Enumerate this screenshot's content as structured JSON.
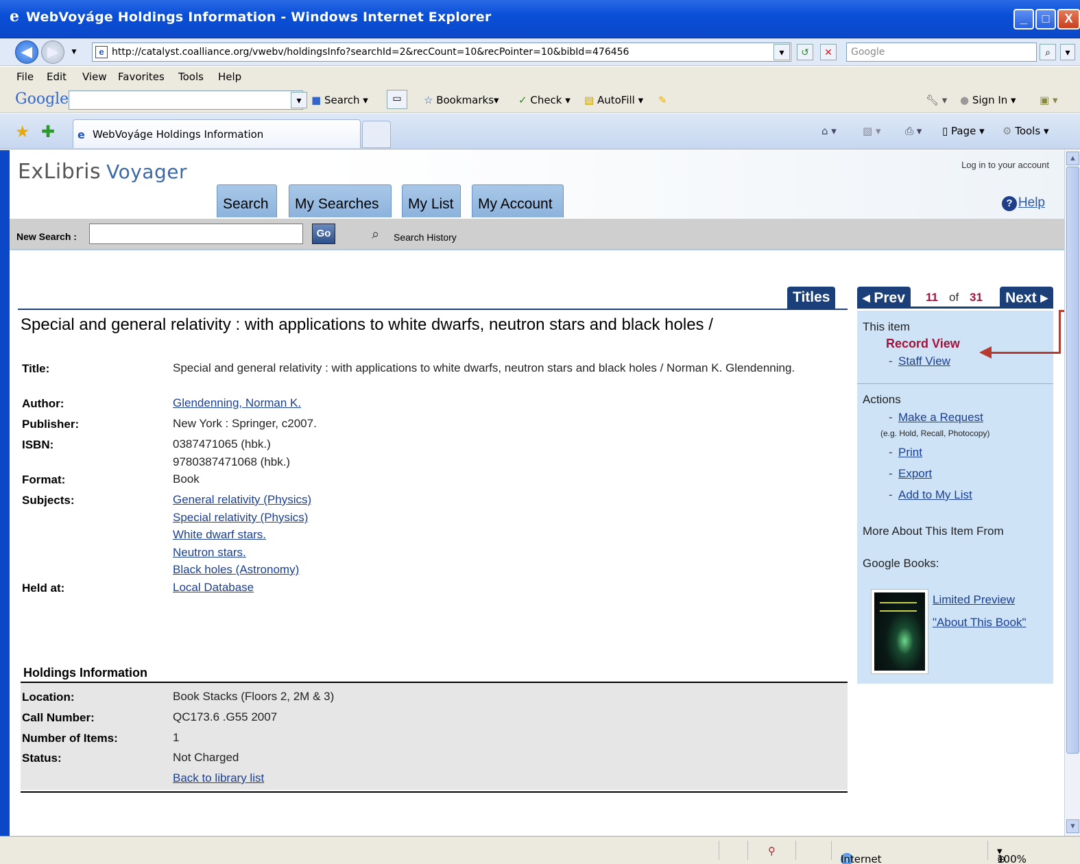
{
  "window": {
    "title": "WebVoyáge Holdings Information - Windows Internet Explorer",
    "url": "http://catalyst.coalliance.org/vwebv/holdingsInfo?searchId=2&recCount=10&recPointer=10&bibId=476456",
    "search_placeholder": "Google",
    "minimize": "_",
    "maximize": "□",
    "close": "X"
  },
  "menu": [
    "File",
    "Edit",
    "View",
    "Favorites",
    "Tools",
    "Help"
  ],
  "google_toolbar": {
    "logo": "Google",
    "search": "Search ▾",
    "bookmarks": "Bookmarks▾",
    "check": "Check ▾",
    "autofill": "AutoFill ▾",
    "sign_in": "Sign In ▾"
  },
  "tabs": {
    "active_tab": "WebVoyáge Holdings Information",
    "page_menu": "Page ▾",
    "tools_menu": "Tools ▾"
  },
  "header": {
    "logo_main": "ExLibris",
    "logo_sub": "Voyager",
    "login_link": "Log in",
    "login_suffix": " to your account",
    "nav_tabs": [
      "Search",
      "My Searches",
      "My List",
      "My Account"
    ],
    "help": "Help",
    "new_search_label": "New Search :",
    "go": "Go",
    "search_history": "Search History"
  },
  "pager": {
    "titles": "Titles",
    "prev": "◂ Prev",
    "current": "11",
    "of": "of",
    "total": "31",
    "next": "Next ▸"
  },
  "record": {
    "heading": "Special and general relativity : with applications to white dwarfs, neutron stars and black holes /",
    "fields": {
      "title_label": "Title:",
      "title_value": "Special and general relativity : with applications to white dwarfs, neutron stars and black holes / Norman K. Glendenning.",
      "author_label": "Author:",
      "author_value": "Glendenning, Norman K.",
      "publisher_label": "Publisher:",
      "publisher_value": "New York : Springer, c2007.",
      "isbn_label": "ISBN:",
      "isbn_1": "0387471065 (hbk.)",
      "isbn_2": "9780387471068 (hbk.)",
      "format_label": "Format:",
      "format_value": "Book",
      "subjects_label": "Subjects:",
      "subjects": [
        "General relativity (Physics)",
        "Special relativity (Physics)",
        "White dwarf stars.",
        "Neutron stars.",
        "Black holes (Astronomy)"
      ],
      "held_label": "Held at:",
      "held_value": "Local Database"
    }
  },
  "holdings": {
    "heading": "Holdings Information",
    "location_label": "Location:",
    "location_value": "Book Stacks (Floors 2, 2M & 3)",
    "call_label": "Call Number:",
    "call_value": "QC173.6 .G55 2007",
    "items_label": "Number of Items:",
    "items_value": "1",
    "status_label": "Status:",
    "status_value": "Not Charged",
    "back_link": "Back to library list"
  },
  "side": {
    "this_item": "This item",
    "record_view": "Record View",
    "staff_view": "Staff View",
    "actions": "Actions",
    "make_request": "Make a Request",
    "request_note": "(e.g. Hold, Recall, Photocopy)",
    "print": "Print",
    "export": "Export",
    "add_list": "Add to My List",
    "more_about": "More About This Item From",
    "google_books": "Google Books:",
    "limited_preview": "Limited Preview",
    "about_book": "\"About This Book\""
  },
  "status": {
    "zone": "Internet",
    "zoom": "100%"
  },
  "colors": {
    "accent_navy": "#1b3f78",
    "record_view_red": "#a0143c",
    "side_panel": "#cfe3f6",
    "annotation_arrow": "#b63c32"
  }
}
